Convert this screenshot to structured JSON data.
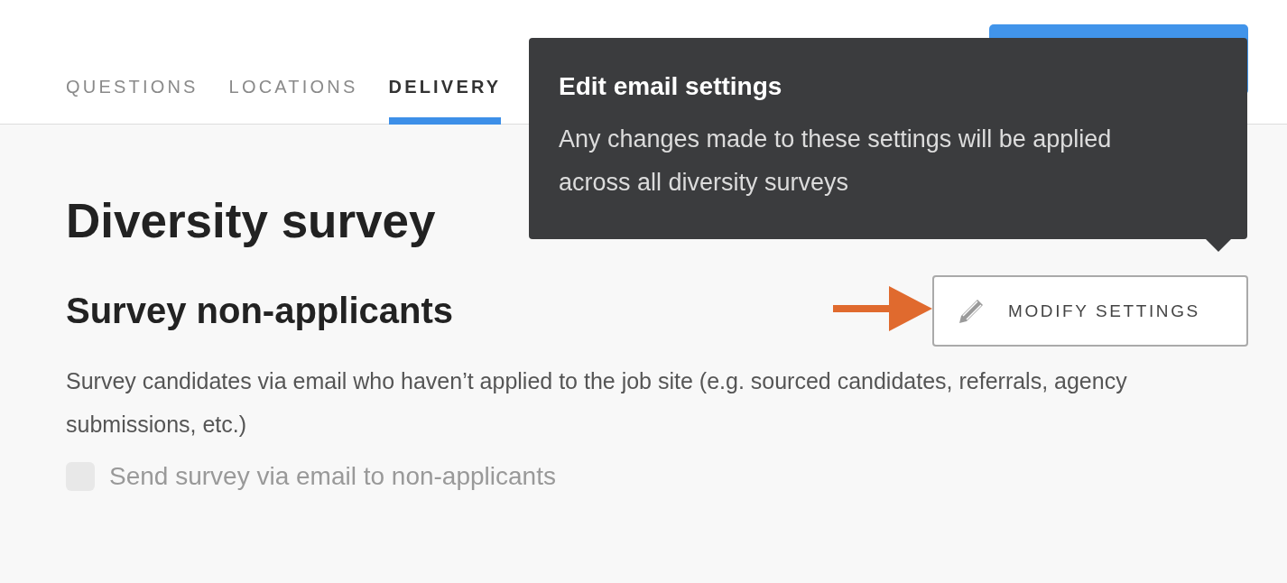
{
  "tabs": [
    {
      "label": "QUESTIONS",
      "selected": false
    },
    {
      "label": "LOCATIONS",
      "selected": false
    },
    {
      "label": "DELIVERY",
      "selected": true
    }
  ],
  "tooltip": {
    "title": "Edit email settings",
    "body": "Any changes made to these settings will be applied across all diversity surveys"
  },
  "page": {
    "title": "Diversity survey",
    "section_title": "Survey non-applicants",
    "modify_button": "MODIFY SETTINGS",
    "description": "Survey candidates via email who haven’t applied to the job site (e.g. sourced candidates, referrals, agency submissions, etc.)",
    "checkbox": {
      "label": "Send survey via email to non-applicants",
      "checked": false,
      "disabled": true
    }
  }
}
